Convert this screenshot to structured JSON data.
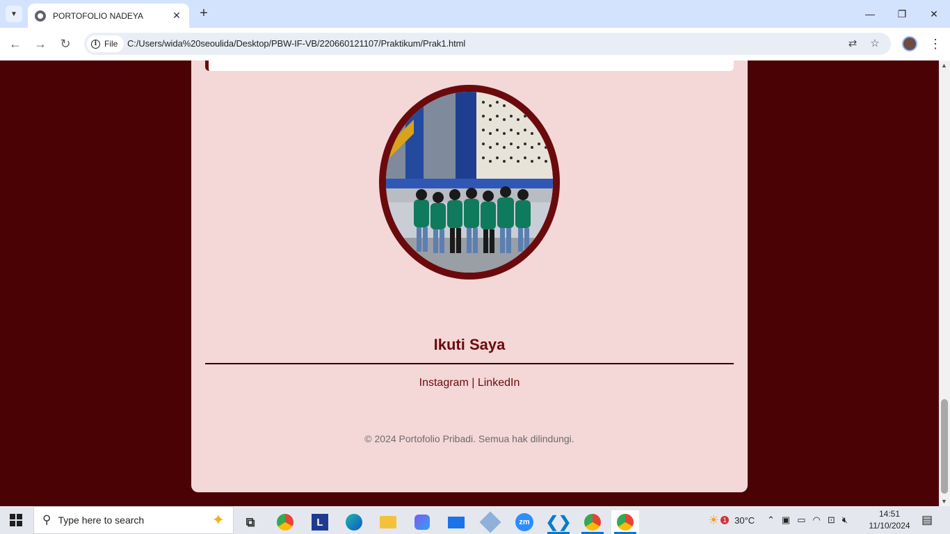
{
  "browser": {
    "tab_title": "PORTOFOLIO NADEYA",
    "chip_label": "File",
    "url": "C:/Users/wida%20seoulida/Desktop/PBW-IF-VB/220660121107/Praktikum/Prak1.html"
  },
  "page": {
    "follow_title": "Ikuti Saya",
    "links": {
      "instagram": "Instagram",
      "separator": "|",
      "linkedin": "LinkedIn"
    },
    "footer": "© 2024 Portofolio Pribadi. Semua hak dilindungi."
  },
  "taskbar": {
    "search_placeholder": "Type here to search",
    "weather": "30°C",
    "weather_badge": "1",
    "time": "14:51",
    "date": "11/10/2024",
    "apps": [
      "Task View",
      "Chrome",
      "L",
      "Edge",
      "File Explorer",
      "Copilot",
      "Mail",
      "Box",
      "Zoom",
      "VS Code",
      "Chrome Profile",
      "Chrome"
    ]
  },
  "colors": {
    "page_background": "#4a0204",
    "card_background": "#f4d7d7",
    "accent": "#6b0a0d",
    "footer_text": "#6b6b6b"
  }
}
